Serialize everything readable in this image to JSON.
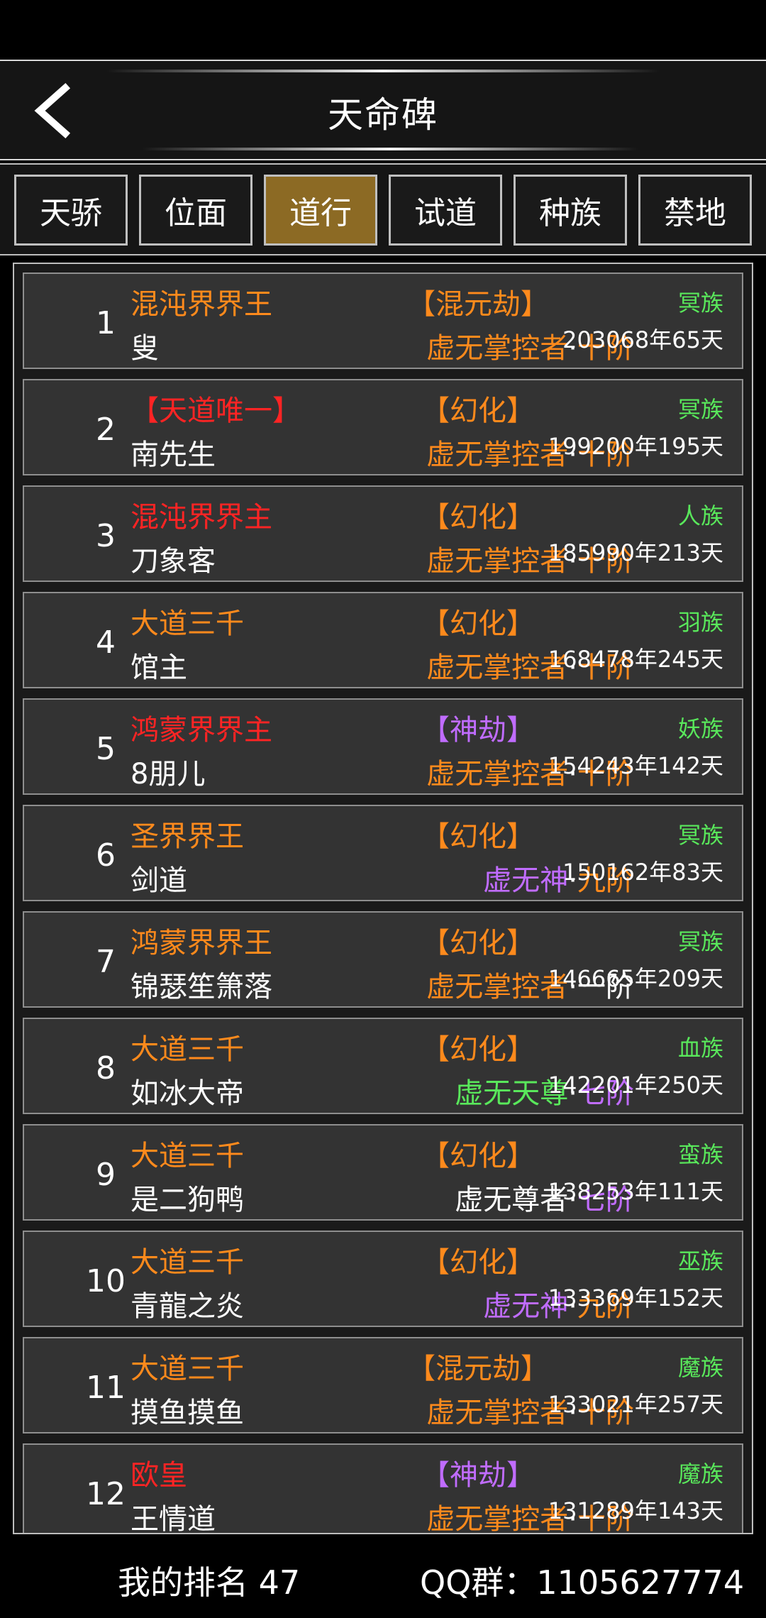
{
  "header": {
    "title": "天命碑"
  },
  "tabs": [
    {
      "label": "天骄",
      "active": false
    },
    {
      "label": "位面",
      "active": false
    },
    {
      "label": "道行",
      "active": true
    },
    {
      "label": "试道",
      "active": false
    },
    {
      "label": "种族",
      "active": false
    },
    {
      "label": "禁地",
      "active": false
    }
  ],
  "colors": {
    "orange": "#ff8a1c",
    "red": "#ff2424",
    "purple": "#c06cff",
    "green": "#59e85b",
    "white": "#ffffff",
    "tab_active": "#8c6a24"
  },
  "rows": [
    {
      "rank": "1",
      "title": "混沌界界王",
      "title_color": "orange",
      "name": "叟",
      "realm": "【混元劫】",
      "realm_color": "orange",
      "level_a": "虚无掌控者",
      "level_a_color": "orange",
      "level_sep": "·",
      "level_b": "十阶",
      "level_b_color": "orange",
      "race": "冥族",
      "time": "203068年65天"
    },
    {
      "rank": "2",
      "title": "【天道唯一】",
      "title_color": "red",
      "name": "南先生",
      "realm": "【幻化】",
      "realm_color": "orange",
      "level_a": "虚无掌控者",
      "level_a_color": "orange",
      "level_sep": "·",
      "level_b": "十阶",
      "level_b_color": "orange",
      "race": "冥族",
      "time": "199200年195天"
    },
    {
      "rank": "3",
      "title": "混沌界界主",
      "title_color": "red",
      "name": "刀象客",
      "realm": "【幻化】",
      "realm_color": "orange",
      "level_a": "虚无掌控者",
      "level_a_color": "orange",
      "level_sep": "·",
      "level_b": "十阶",
      "level_b_color": "orange",
      "race": "人族",
      "time": "185990年213天"
    },
    {
      "rank": "4",
      "title": "大道三千",
      "title_color": "orange",
      "name": "馆主",
      "realm": "【幻化】",
      "realm_color": "orange",
      "level_a": "虚无掌控者",
      "level_a_color": "orange",
      "level_sep": "·",
      "level_b": "十阶",
      "level_b_color": "orange",
      "race": "羽族",
      "time": "168478年245天"
    },
    {
      "rank": "5",
      "title": "鸿蒙界界主",
      "title_color": "red",
      "name": "8朋儿",
      "realm": "【神劫】",
      "realm_color": "purple",
      "level_a": "虚无掌控者",
      "level_a_color": "orange",
      "level_sep": "·",
      "level_b": "十阶",
      "level_b_color": "orange",
      "race": "妖族",
      "time": "154243年142天"
    },
    {
      "rank": "6",
      "title": "圣界界王",
      "title_color": "orange",
      "name": "剑道",
      "realm": "【幻化】",
      "realm_color": "orange",
      "level_a": "虚无神",
      "level_a_color": "purple",
      "level_sep": "·",
      "level_b": "九阶",
      "level_b_color": "orange",
      "race": "冥族",
      "time": "150162年83天"
    },
    {
      "rank": "7",
      "title": "鸿蒙界界王",
      "title_color": "orange",
      "name": "锦瑟笙箫落",
      "realm": "【幻化】",
      "realm_color": "orange",
      "level_a": "虚无掌控者",
      "level_a_color": "orange",
      "level_sep": "·",
      "level_b": "一阶",
      "level_b_color": "white",
      "race": "冥族",
      "time": "146665年209天"
    },
    {
      "rank": "8",
      "title": "大道三千",
      "title_color": "orange",
      "name": "如冰大帝",
      "realm": "【幻化】",
      "realm_color": "orange",
      "level_a": "虚无天尊",
      "level_a_color": "green",
      "level_sep": "·",
      "level_b": "七阶",
      "level_b_color": "purple",
      "race": "血族",
      "time": "142201年250天"
    },
    {
      "rank": "9",
      "title": "大道三千",
      "title_color": "orange",
      "name": "是二狗鸭",
      "realm": "【幻化】",
      "realm_color": "orange",
      "level_a": "虚无尊者",
      "level_a_color": "white",
      "level_sep": "·",
      "level_b": "七阶",
      "level_b_color": "purple",
      "race": "蛮族",
      "time": "138253年111天"
    },
    {
      "rank": "10",
      "title": "大道三千",
      "title_color": "orange",
      "name": "青龍之炎",
      "realm": "【幻化】",
      "realm_color": "orange",
      "level_a": "虚无神",
      "level_a_color": "purple",
      "level_sep": "·",
      "level_b": "九阶",
      "level_b_color": "orange",
      "race": "巫族",
      "time": "133369年152天"
    },
    {
      "rank": "11",
      "title": "大道三千",
      "title_color": "orange",
      "name": "摸鱼摸鱼",
      "realm": "【混元劫】",
      "realm_color": "orange",
      "level_a": "虚无掌控者",
      "level_a_color": "orange",
      "level_sep": "·",
      "level_b": "十阶",
      "level_b_color": "orange",
      "race": "魔族",
      "time": "133021年257天"
    },
    {
      "rank": "12",
      "title": "欧皇",
      "title_color": "red",
      "name": "王情道",
      "realm": "【神劫】",
      "realm_color": "purple",
      "level_a": "虚无掌控者",
      "level_a_color": "orange",
      "level_sep": "·",
      "level_b": "十阶",
      "level_b_color": "orange",
      "race": "魔族",
      "time": "131289年143天"
    }
  ],
  "footer": {
    "my_rank": "我的排名 47",
    "qq_group": "QQ群：1105627774"
  }
}
